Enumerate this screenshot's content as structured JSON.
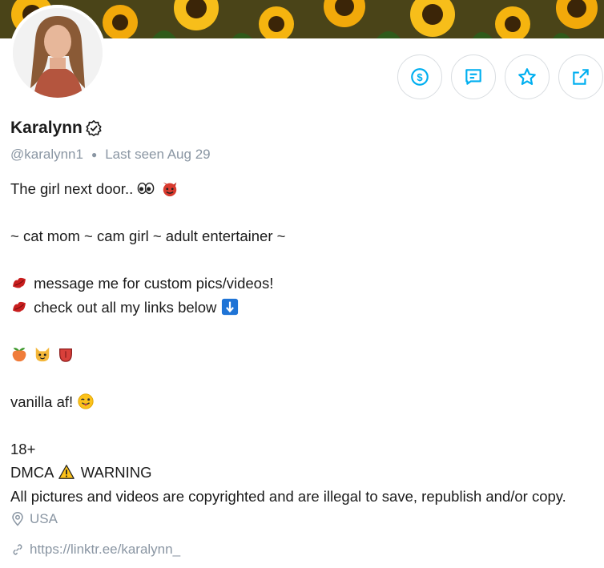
{
  "profile": {
    "name": "Karalynn",
    "handle": "@karalynn1",
    "last_seen": "Last seen Aug 29",
    "location": "USA",
    "website": "https://linktr.ee/karalynn_"
  },
  "bio": {
    "line1": "The girl next door..",
    "line2": "~ cat mom ~ cam girl ~ adult entertainer ~",
    "line3": "message me for custom pics/videos!",
    "line4": "check out all my links below",
    "line5": "vanilla af!",
    "line6": "18+",
    "line7a": "DMCA",
    "line7b": "WARNING",
    "line8": "All pictures and videos are copyrighted and are illegal to save, republish and/or copy."
  },
  "actions": {
    "tip_icon": "dollar-circle-icon",
    "message_icon": "message-icon",
    "favorite_icon": "star-icon",
    "share_icon": "share-icon"
  },
  "colors": {
    "accent": "#00aff0",
    "muted": "#8a96a3",
    "text": "#1b1b1b"
  }
}
